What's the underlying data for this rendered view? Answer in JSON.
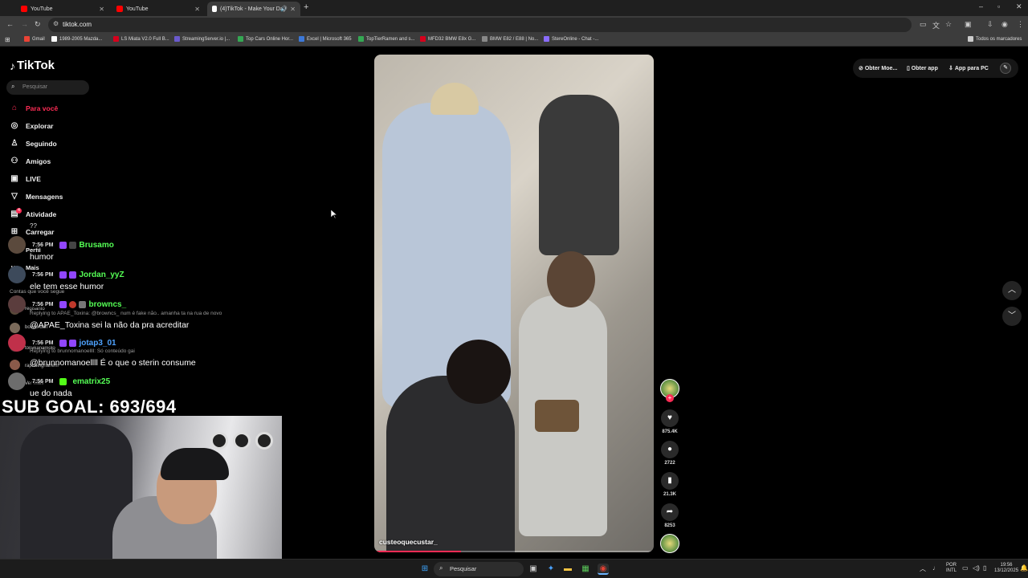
{
  "browser": {
    "tabs": [
      {
        "title": "YouTube",
        "favicon_color": "#ff0000",
        "active": false
      },
      {
        "title": "YouTube",
        "favicon_color": "#ff0000",
        "active": false
      },
      {
        "title": "(4)TikTok - Make Your Day",
        "favicon_color": "#ffffff",
        "active": true
      }
    ],
    "url": "tiktok.com",
    "bookmarks": [
      {
        "label": "Gmail",
        "color": "#ea4335"
      },
      {
        "label": "1989-2005 Mazda...",
        "color": "#ffffff"
      },
      {
        "label": "LS Miata V2.0 Full B...",
        "color": "#d6001c"
      },
      {
        "label": "StreamingServer.io |...",
        "color": "#6a5acd"
      },
      {
        "label": "Top Cars Online Hor...",
        "color": "#34a853"
      },
      {
        "label": "Excel | Microsoft 365",
        "color": "#3c78d8"
      },
      {
        "label": "TopTierRamen and s...",
        "color": "#34a853"
      },
      {
        "label": "MFD32 BMW E8x G...",
        "color": "#d6001c"
      },
      {
        "label": "BMW E82 / E88 | No...",
        "color": "#888888"
      },
      {
        "label": "StereOnline - Chat -...",
        "color": "#8a6cff"
      }
    ],
    "all_bookmarks": "Todos os marcadores"
  },
  "tiktok": {
    "logo": "TikTok",
    "search_placeholder": "Pesquisar",
    "nav": [
      {
        "label": "Para você",
        "icon": "home-icon",
        "active": true
      },
      {
        "label": "Explorar",
        "icon": "compass-icon",
        "active": false
      },
      {
        "label": "Seguindo",
        "icon": "following-icon",
        "active": false
      },
      {
        "label": "Amigos",
        "icon": "friends-icon",
        "active": false
      },
      {
        "label": "LIVE",
        "icon": "live-icon",
        "active": false
      },
      {
        "label": "Mensagens",
        "icon": "messages-icon",
        "active": false
      },
      {
        "label": "Atividade",
        "icon": "activity-icon",
        "active": false
      },
      {
        "label": "Carregar",
        "icon": "upload-icon",
        "active": false
      },
      {
        "label": "Perfil",
        "icon": "profile-icon",
        "active": false
      },
      {
        "label": "Mais",
        "icon": "more-icon",
        "active": false
      }
    ],
    "activity_badge": "4",
    "following_label": "Contas que você segue",
    "following": [
      "regisanto",
      "boxdoruan",
      "tonykanamoto",
      "raphaelghanem",
      "Ver mais"
    ],
    "top_right": {
      "coins": "Obter Moe...",
      "app": "Obter app",
      "pc": "App para PC"
    },
    "video": {
      "author": "custeoquecustar_",
      "progress": 0.31,
      "likes": "875.4K",
      "comments": "2722",
      "saves": "21.3K",
      "shares": "8253"
    }
  },
  "overlay": {
    "chat": [
      {
        "time": "7:56 PM",
        "user": "Brusamo",
        "user_color": "#55ff55",
        "message": "humor",
        "reply": ""
      },
      {
        "time": "7:56 PM",
        "user": "Jordan_yyZ",
        "user_color": "#55ff55",
        "message": "ele tem esse humor",
        "reply": ""
      },
      {
        "time": "7:56 PM",
        "user": "browncs_",
        "user_color": "#55ff55",
        "message": "@APAE_Toxina sei la não da pra acreditar",
        "reply": "Replying to APAE_Toxina: @browncs_ num é fake não.. amanha ta na rua de novo"
      },
      {
        "time": "7:56 PM",
        "user": "jotap3_01",
        "user_color": "#4fa3ff",
        "message": "@brunnomanoellll É o que o sterin consume",
        "reply": "Replying to brunnomanoellll: Só conteúdo gai"
      },
      {
        "time": "7:56 PM",
        "user": "ematrix25",
        "user_color": "#55ff55",
        "message": "ue do nada",
        "reply": ""
      }
    ],
    "sub_goal": "SUB GOAL: 693/694",
    "partial_text": "??"
  },
  "taskbar": {
    "search_label": "Pesquisar",
    "lang_top": "POR",
    "lang_bottom": "INTL",
    "time": "19:56",
    "date": "13/12/2025"
  }
}
